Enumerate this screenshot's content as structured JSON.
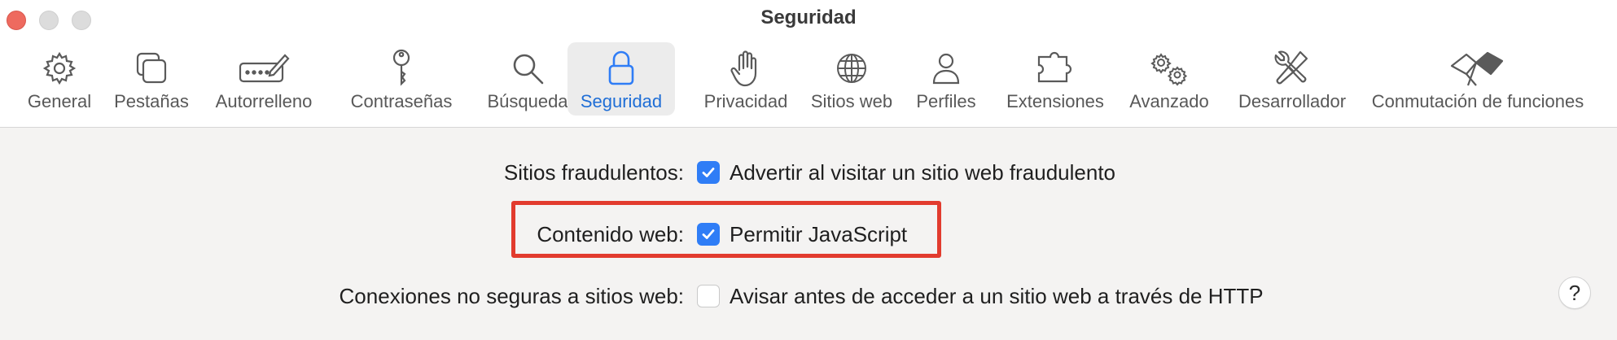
{
  "window": {
    "title": "Seguridad"
  },
  "toolbar": {
    "tabs": [
      {
        "label": "General",
        "icon": "gear-icon"
      },
      {
        "label": "Pestañas",
        "icon": "tabs-icon"
      },
      {
        "label": "Autorrelleno",
        "icon": "autofill-pencil-icon"
      },
      {
        "label": "Contraseñas",
        "icon": "key-icon"
      },
      {
        "label": "Búsqueda",
        "icon": "magnifier-icon"
      },
      {
        "label": "Seguridad",
        "icon": "lock-icon",
        "active": true
      },
      {
        "label": "Privacidad",
        "icon": "hand-icon"
      },
      {
        "label": "Sitios web",
        "icon": "globe-icon"
      },
      {
        "label": "Perfiles",
        "icon": "person-icon"
      },
      {
        "label": "Extensiones",
        "icon": "puzzle-icon"
      },
      {
        "label": "Avanzado",
        "icon": "gears-icon"
      },
      {
        "label": "Desarrollador",
        "icon": "tools-icon"
      },
      {
        "label": "Conmutación de funciones",
        "icon": "flags-icon"
      }
    ]
  },
  "settings": [
    {
      "label": "Sitios fraudulentos:",
      "option": "Advertir al visitar un sitio web fraudulento",
      "checked": true
    },
    {
      "label": "Contenido web:",
      "option": "Permitir JavaScript",
      "checked": true,
      "highlighted": true
    },
    {
      "label": "Conexiones no seguras a sitios web:",
      "option": "Avisar antes de acceder a un sitio web a través de HTTP",
      "checked": false
    }
  ],
  "help": {
    "label": "?"
  },
  "colors": {
    "accent": "#2f7df6",
    "active_label": "#1f6ed6",
    "highlight": "#e23b2e"
  }
}
